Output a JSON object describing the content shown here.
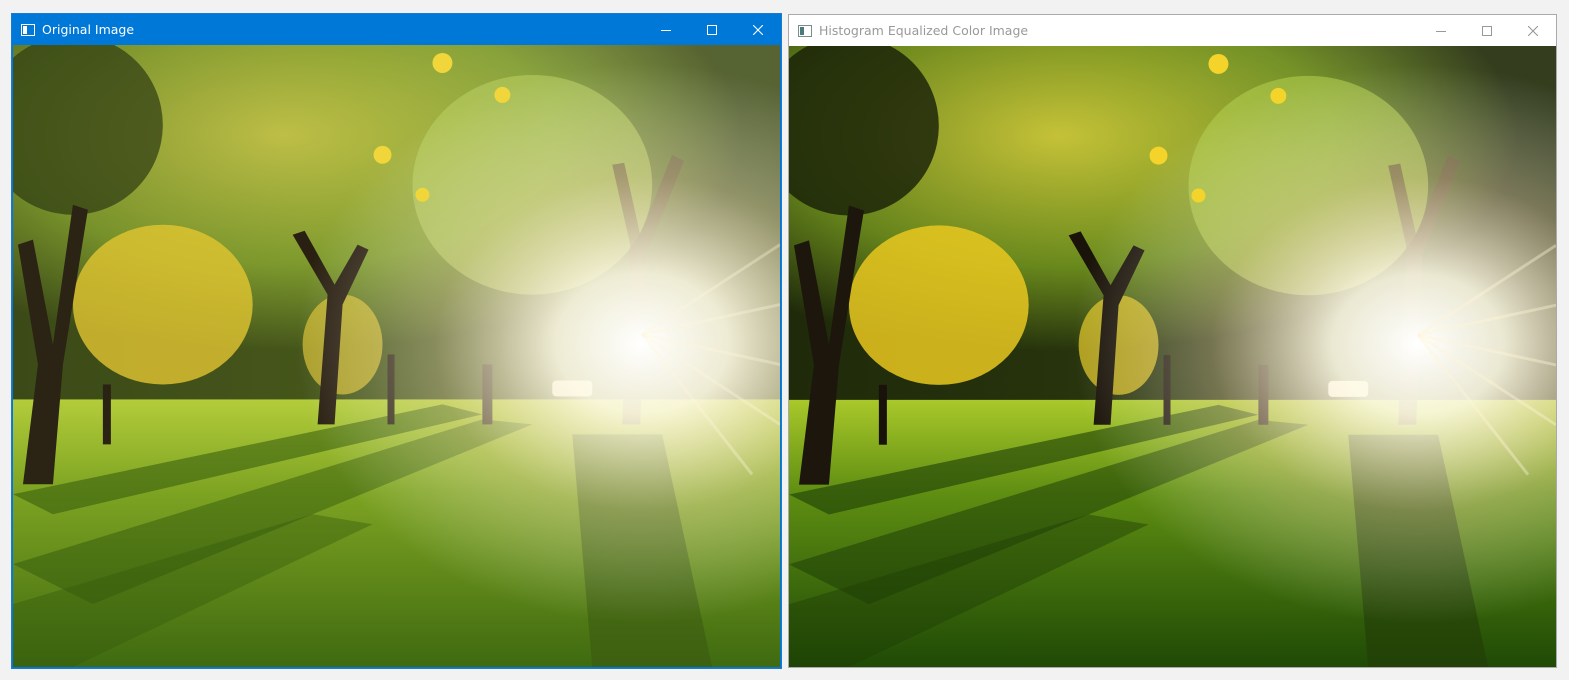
{
  "windows": [
    {
      "title": "Original Image",
      "active": true,
      "image_alt": "Sunlit park with autumn trees, long shadows on green grass"
    },
    {
      "title": "Histogram Equalized Color Image",
      "active": false,
      "image_alt": "Histogram-equalized version of the sunlit park photo with higher contrast"
    }
  ],
  "colors": {
    "active_titlebar": "#0078d7",
    "inactive_titlebar": "#ffffff",
    "active_title_text": "#ffffff",
    "inactive_title_text": "#999999"
  },
  "icons": [
    "app-window-icon",
    "minimize-icon",
    "maximize-icon",
    "close-icon"
  ]
}
